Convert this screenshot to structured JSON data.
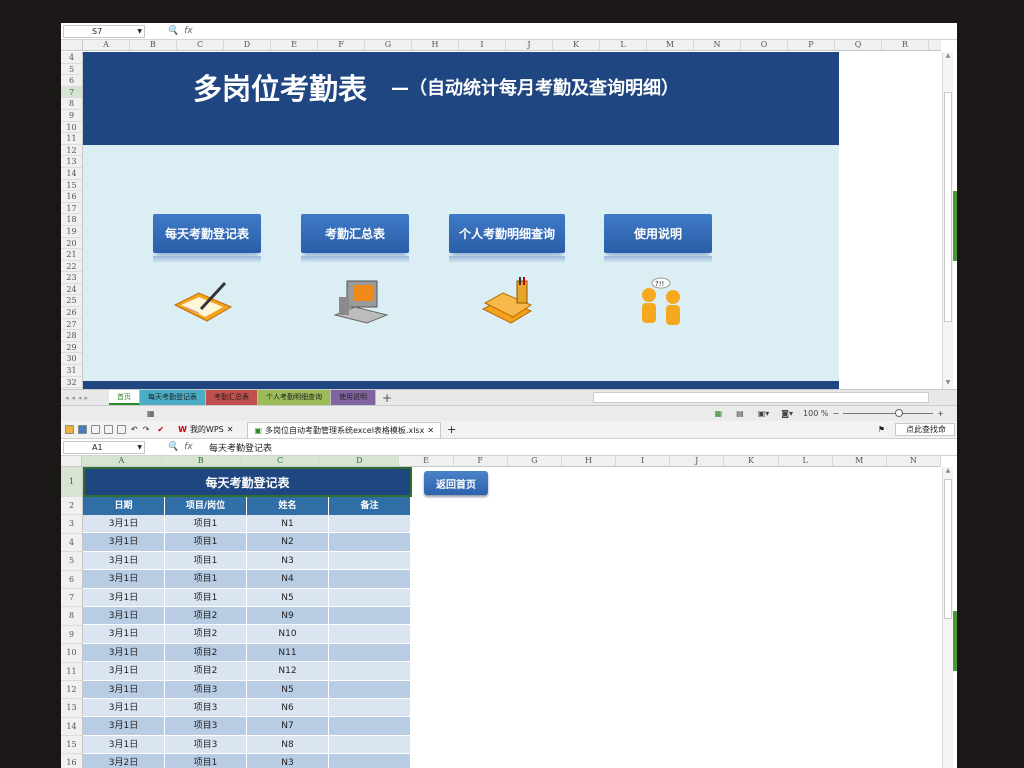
{
  "top_window": {
    "namebox": "S7",
    "formula": "",
    "columns": [
      "A",
      "B",
      "C",
      "D",
      "E",
      "F",
      "G",
      "H",
      "I",
      "J",
      "K",
      "L",
      "M",
      "N",
      "O",
      "P",
      "Q",
      "R"
    ],
    "rows": [
      "4",
      "5",
      "6",
      "7",
      "8",
      "9",
      "10",
      "11",
      "12",
      "13",
      "14",
      "15",
      "16",
      "17",
      "18",
      "19",
      "20",
      "21",
      "22",
      "23",
      "24",
      "25",
      "26",
      "27",
      "28",
      "29",
      "30",
      "31",
      "32"
    ],
    "selected_row": "7",
    "dashboard": {
      "title": "多岗位考勤表",
      "subtitle": "—（自动统计每月考勤及查询明细）",
      "buttons": [
        "每天考勤登记表",
        "考勤汇总表",
        "个人考勤明细查询",
        "使用说明"
      ],
      "icons": [
        "writing-pad-icon",
        "computer-icon",
        "books-icon",
        "people-question-icon"
      ]
    },
    "sheet_tabs": [
      {
        "label": "首页",
        "color": "#ffffff",
        "active": true
      },
      {
        "label": "每天考勤登记表",
        "color": "#4bacc6"
      },
      {
        "label": "考勤汇总表",
        "color": "#c0504d"
      },
      {
        "label": "个人考勤明细查询",
        "color": "#9bbb59"
      },
      {
        "label": "使用说明",
        "color": "#8064a2"
      }
    ],
    "zoom": "100 %"
  },
  "bottom_window": {
    "wps_tab": "我的WPS",
    "doc_tab": "多岗位自动考勤管理系统excel表格模板.xlsx",
    "search_placeholder": "点此查找命",
    "namebox": "A1",
    "formula": "每天考勤登记表",
    "columns": [
      "A",
      "B",
      "C",
      "D",
      "E",
      "F",
      "G",
      "H",
      "I",
      "J",
      "K",
      "L",
      "M",
      "N"
    ],
    "table": {
      "title": "每天考勤登记表",
      "headers": [
        "日期",
        "项目/岗位",
        "姓名",
        "备注"
      ],
      "rows": [
        [
          "3月1日",
          "项目1",
          "N1",
          ""
        ],
        [
          "3月1日",
          "项目1",
          "N2",
          ""
        ],
        [
          "3月1日",
          "项目1",
          "N3",
          ""
        ],
        [
          "3月1日",
          "项目1",
          "N4",
          ""
        ],
        [
          "3月1日",
          "项目1",
          "N5",
          ""
        ],
        [
          "3月1日",
          "项目2",
          "N9",
          ""
        ],
        [
          "3月1日",
          "项目2",
          "N10",
          ""
        ],
        [
          "3月1日",
          "项目2",
          "N11",
          ""
        ],
        [
          "3月1日",
          "项目2",
          "N12",
          ""
        ],
        [
          "3月1日",
          "项目3",
          "N5",
          ""
        ],
        [
          "3月1日",
          "项目3",
          "N6",
          ""
        ],
        [
          "3月1日",
          "项目3",
          "N7",
          ""
        ],
        [
          "3月1日",
          "项目3",
          "N8",
          ""
        ],
        [
          "3月2日",
          "项目1",
          "N3",
          ""
        ]
      ]
    },
    "back_button": "返回首页"
  }
}
